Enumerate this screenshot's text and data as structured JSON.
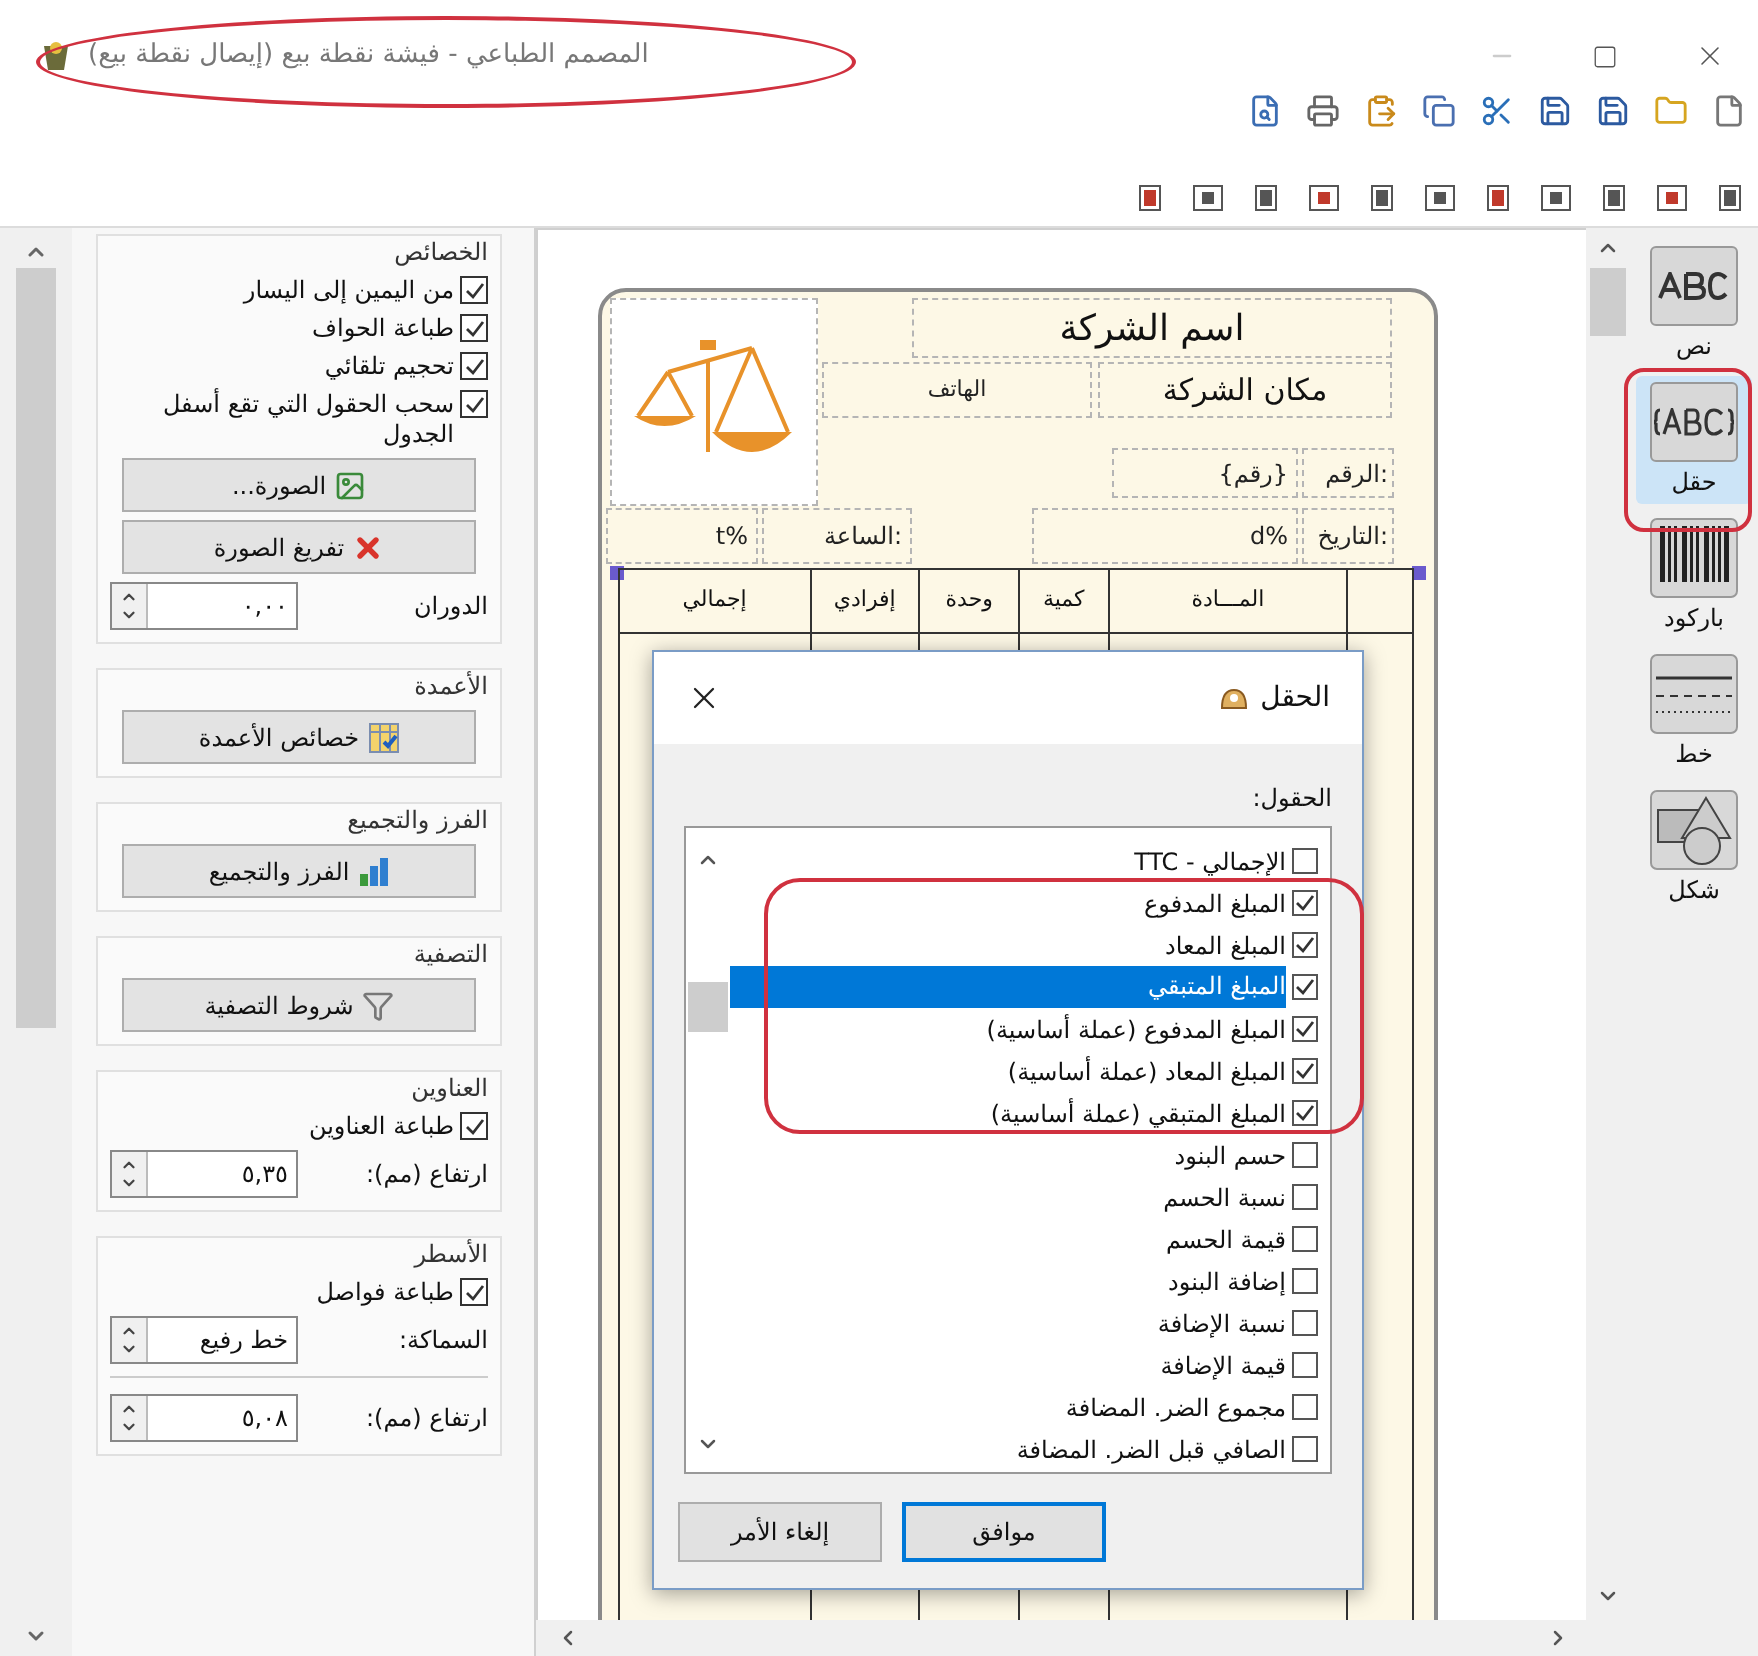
{
  "window": {
    "title": "المصمم الطباعي - فيشة نقطة بيع (إيصال نقطة بيع)"
  },
  "left_panel": {
    "sections": [
      {
        "title": "الخصائص",
        "items": [
          {
            "kind": "checkbox",
            "label": "من اليمين إلى اليسار",
            "checked": true
          },
          {
            "kind": "checkbox",
            "label": "طباعة الحواف",
            "checked": true
          },
          {
            "kind": "checkbox",
            "label": "تحجيم تلقائي",
            "checked": true
          },
          {
            "kind": "checkbox",
            "label": "سحب الحقول التي تقع أسفل الجدول",
            "checked": true
          },
          {
            "kind": "button",
            "label": "الصورة..."
          },
          {
            "kind": "button",
            "label": "تفريغ الصورة"
          },
          {
            "kind": "spin",
            "label": "الدوران",
            "value": "٠,٠٠"
          }
        ]
      },
      {
        "title": "الأعمدة",
        "items": [
          {
            "kind": "button",
            "label": "خصائص الأعمدة"
          }
        ]
      },
      {
        "title": "الفرز والتجميع",
        "items": [
          {
            "kind": "button",
            "label": "الفرز والتجميع"
          }
        ]
      },
      {
        "title": "التصفية",
        "items": [
          {
            "kind": "button",
            "label": "شروط التصفية"
          }
        ]
      },
      {
        "title": "العناوين",
        "items": [
          {
            "kind": "checkbox",
            "label": "طباعة العناوين",
            "checked": true
          },
          {
            "kind": "spin",
            "label": "ارتفاع (مم):",
            "value": "٥,٣٥"
          }
        ]
      },
      {
        "title": "الأسطر",
        "items": [
          {
            "kind": "checkbox",
            "label": "طباعة فواصل",
            "checked": true
          },
          {
            "kind": "spin",
            "label": "السماكة:",
            "value": "خط رفيع"
          },
          {
            "kind": "spin",
            "label": "ارتفاع (مم):",
            "value": "٥,٠٨"
          }
        ]
      }
    ]
  },
  "report": {
    "company_name": "اسم الشركة",
    "company_place": "مكان الشركة",
    "phone": "الهاتف",
    "number_label": "الرقم:",
    "number_value": "{رقم}",
    "date_label": "التاريخ:",
    "date_value": "d%",
    "time_label": "الساعة:",
    "time_value": "t%",
    "columns": [
      "المـــادة",
      "كمية",
      "وحدة",
      "إفرادي",
      "إجمالي"
    ]
  },
  "dialog": {
    "title": "الحقل",
    "fields_label": "الحقول:",
    "items": [
      {
        "label": "الإجمالي - TTC",
        "checked": false,
        "selected": false
      },
      {
        "label": "المبلغ المدفوع",
        "checked": true,
        "selected": false
      },
      {
        "label": "المبلغ المعاد",
        "checked": true,
        "selected": false
      },
      {
        "label": "المبلغ المتبقي",
        "checked": true,
        "selected": true
      },
      {
        "label": "المبلغ المدفوع (عملة أساسية)",
        "checked": true,
        "selected": false
      },
      {
        "label": "المبلغ المعاد (عملة أساسية)",
        "checked": true,
        "selected": false
      },
      {
        "label": "المبلغ المتبقي (عملة أساسية)",
        "checked": true,
        "selected": false
      },
      {
        "label": "حسم البنود",
        "checked": false,
        "selected": false
      },
      {
        "label": "نسبة الحسم",
        "checked": false,
        "selected": false
      },
      {
        "label": "قيمة الحسم",
        "checked": false,
        "selected": false
      },
      {
        "label": "إضافة البنود",
        "checked": false,
        "selected": false
      },
      {
        "label": "نسبة الإضافة",
        "checked": false,
        "selected": false
      },
      {
        "label": "قيمة الإضافة",
        "checked": false,
        "selected": false
      },
      {
        "label": "مجموع الضر. المضافة",
        "checked": false,
        "selected": false
      },
      {
        "label": "الصافي قبل الضر. المضافة",
        "checked": false,
        "selected": false
      }
    ],
    "buttons": [
      {
        "label": "موافق",
        "default": true
      },
      {
        "label": "إلغاء الأمر",
        "default": false
      }
    ]
  },
  "toolbox": {
    "items": [
      {
        "label": "نص",
        "selected": false
      },
      {
        "label": "حقل",
        "selected": true
      },
      {
        "label": "باركود",
        "selected": false
      },
      {
        "label": "خط",
        "selected": false
      },
      {
        "label": "شكل",
        "selected": false
      }
    ]
  }
}
